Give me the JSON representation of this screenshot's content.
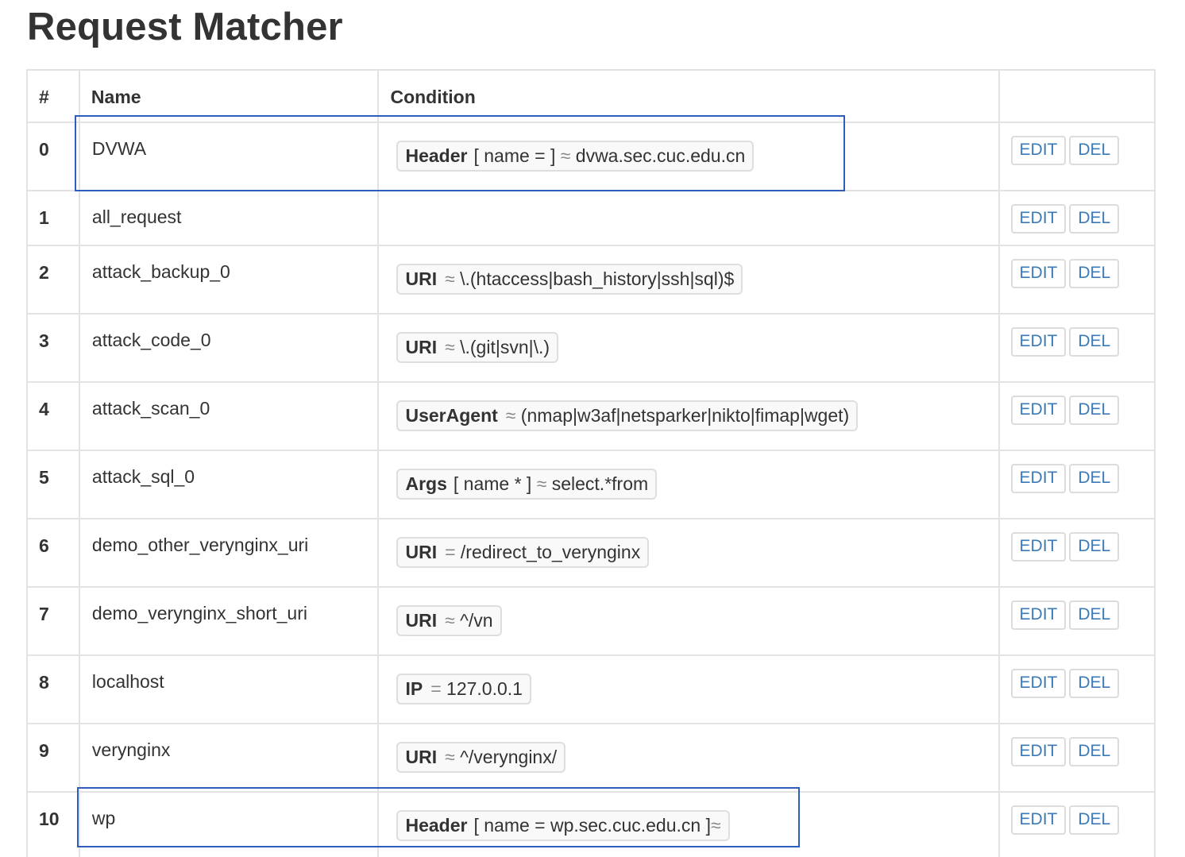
{
  "title": "Request Matcher",
  "columns": {
    "index": "#",
    "name": "Name",
    "condition": "Condition",
    "actions": ""
  },
  "actions": {
    "edit": "EDIT",
    "del": "DEL"
  },
  "rows": [
    {
      "index": "0",
      "name": "DVWA",
      "condition": {
        "key": "Header",
        "option": "[ name = ]",
        "operator": "≈",
        "value": "dvwa.sec.cuc.edu.cn"
      }
    },
    {
      "index": "1",
      "name": "all_request",
      "condition": null
    },
    {
      "index": "2",
      "name": "attack_backup_0",
      "condition": {
        "key": "URI",
        "operator": "≈",
        "value": "\\.(htaccess|bash_history|ssh|sql)$"
      }
    },
    {
      "index": "3",
      "name": "attack_code_0",
      "condition": {
        "key": "URI",
        "operator": "≈",
        "value": "\\.(git|svn|\\.)"
      }
    },
    {
      "index": "4",
      "name": "attack_scan_0",
      "condition": {
        "key": "UserAgent",
        "operator": "≈",
        "value": "(nmap|w3af|netsparker|nikto|fimap|wget)"
      }
    },
    {
      "index": "5",
      "name": "attack_sql_0",
      "condition": {
        "key": "Args",
        "option": "[ name * ]",
        "operator": "≈",
        "value": "select.*from"
      }
    },
    {
      "index": "6",
      "name": "demo_other_verynginx_uri",
      "condition": {
        "key": "URI",
        "operator": "=",
        "value": "/redirect_to_verynginx"
      }
    },
    {
      "index": "7",
      "name": "demo_verynginx_short_uri",
      "condition": {
        "key": "URI",
        "operator": "≈",
        "value": "^/vn"
      }
    },
    {
      "index": "8",
      "name": "localhost",
      "condition": {
        "key": "IP",
        "operator": "=",
        "value": "127.0.0.1"
      }
    },
    {
      "index": "9",
      "name": "verynginx",
      "condition": {
        "key": "URI",
        "operator": "≈",
        "value": "^/verynginx/"
      }
    },
    {
      "index": "10",
      "name": "wp",
      "condition": {
        "key": "Header",
        "option": "[ name = wp.sec.cuc.edu.cn ]",
        "operator": "≈",
        "value": ""
      }
    }
  ],
  "highlights": {
    "color": "#2f5dbb",
    "rows": [
      "0",
      "10"
    ]
  }
}
